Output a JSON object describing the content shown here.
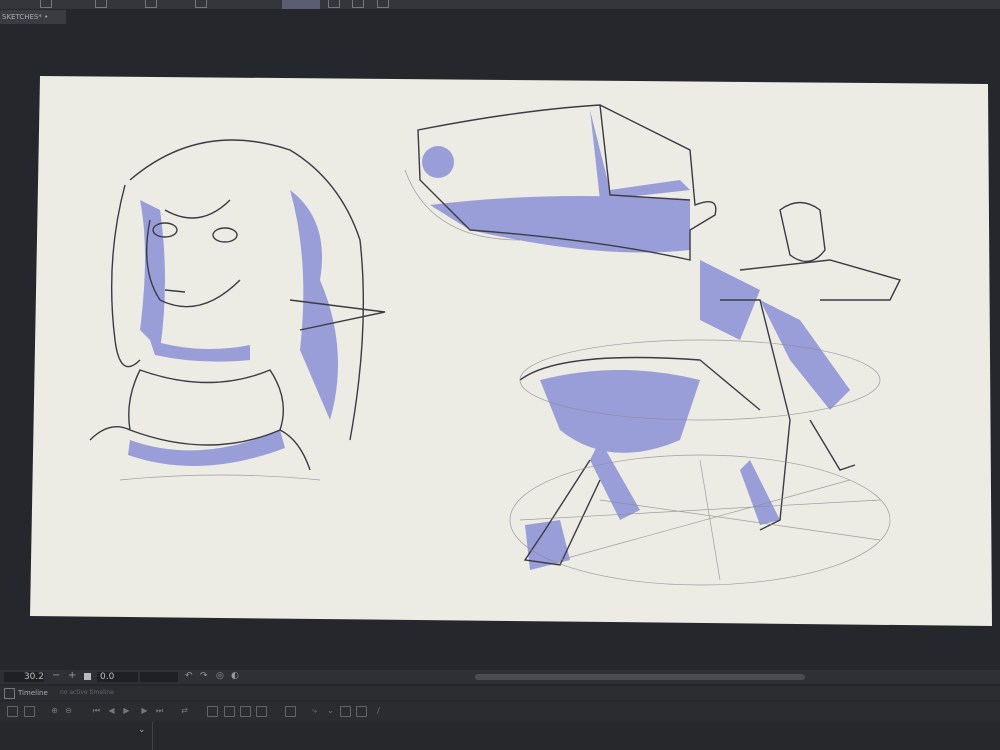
{
  "app": {
    "document_tab": "SKETCHES*"
  },
  "controls": {
    "zoom_value": "30.2",
    "rotation_value": "0.0",
    "minus": "−",
    "plus": "+"
  },
  "timeline": {
    "panel_label": "Timeline",
    "secondary_label": "no active timeline"
  },
  "colors": {
    "canvas": "#ecebe4",
    "shade": "#9a9ed8",
    "ui_dark": "#25272c"
  },
  "icons": [
    "new-timeline-icon",
    "zoom-in-icon",
    "zoom-out-icon",
    "first-frame-icon",
    "prev-frame-icon",
    "play-icon",
    "next-frame-icon",
    "last-frame-icon",
    "loop-icon",
    "onion-skin-icon",
    "chevron-down-icon",
    "pen-icon"
  ]
}
